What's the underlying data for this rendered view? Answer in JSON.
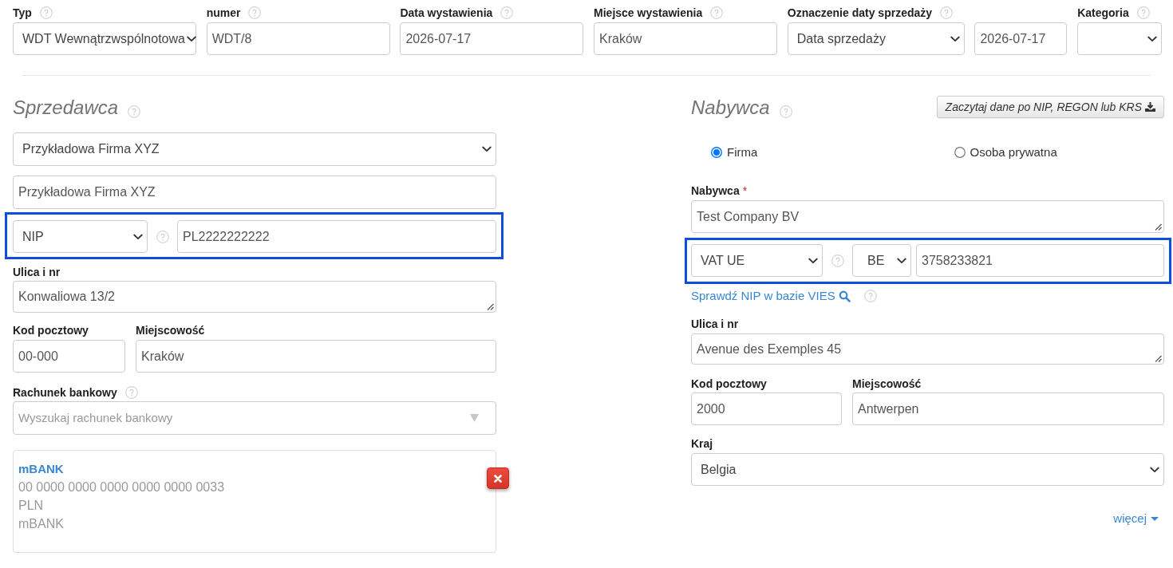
{
  "header_fields": [
    {
      "label": "Typ",
      "help_icon": true,
      "kind": "select",
      "value": "WDT Wewnątrzwspólnotowa"
    },
    {
      "label": "numer",
      "help_icon": true,
      "kind": "input",
      "value": "WDT/8"
    },
    {
      "label": "Data wystawienia",
      "help_icon": true,
      "kind": "input",
      "value": "2026-07-17"
    },
    {
      "label": "Miejsce wystawienia",
      "help_icon": true,
      "kind": "input",
      "value": "Kraków"
    },
    {
      "label": "Oznaczenie daty sprzedaży",
      "help_icon": true,
      "kind": "select",
      "value": "Data sprzedaży"
    },
    {
      "kind": "input",
      "value": "2026-07-17"
    },
    {
      "label": "Kategoria",
      "help_icon": true,
      "kind": "select"
    }
  ],
  "seller": {
    "title": "Sprzedawca",
    "help_icon": true,
    "company": "Przykładowa Firma XYZ",
    "name": "Przykładowa Firma XYZ",
    "tax_id": {
      "highlighted": true,
      "type": "NIP",
      "help_icon": true,
      "value": "PL2222222222"
    },
    "street": {
      "label": "Ulica i nr",
      "value": "Konwaliowa 13/2"
    },
    "postal_code": {
      "label": "Kod pocztowy",
      "value": "00-000"
    },
    "city": {
      "label": "Miejscowość",
      "value": "Kraków"
    },
    "bank_account": {
      "label": "Rachunek bankowy",
      "help_icon": true,
      "placeholder": "Wyszukaj rachunek bankowy",
      "chosen": {
        "bank": "mBANK",
        "number": "00 0000 0000 0000 0000 0000 0033",
        "currency": "PLN",
        "name": "mBANK"
      }
    }
  },
  "buyer": {
    "title": "Nabywca",
    "help_icon": true,
    "lookup_button": "Zaczytaj dane po NIP, REGON lub KRS",
    "entity_types": [
      {
        "label": "Firma",
        "selected": true
      },
      {
        "label": "Osoba prywatna",
        "selected": false
      }
    ],
    "name": {
      "label": "Nabywca",
      "required_mark": "*",
      "value": "Test Company BV"
    },
    "tax_id": {
      "highlighted": true,
      "type": "VAT UE",
      "help_icon": true,
      "country": "BE",
      "value": "3758233821"
    },
    "vies_link": {
      "label": "Sprawdź NIP w bazie VIES",
      "help_icon": true
    },
    "street": {
      "label": "Ulica i nr",
      "value": "Avenue des Exemples 45"
    },
    "postal_code": {
      "label": "Kod pocztowy",
      "value": "2000"
    },
    "city": {
      "label": "Miejscowość",
      "value": "Antwerpen"
    },
    "country": {
      "label": "Kraj",
      "value": "Belgia"
    },
    "more_link": "więcej"
  }
}
